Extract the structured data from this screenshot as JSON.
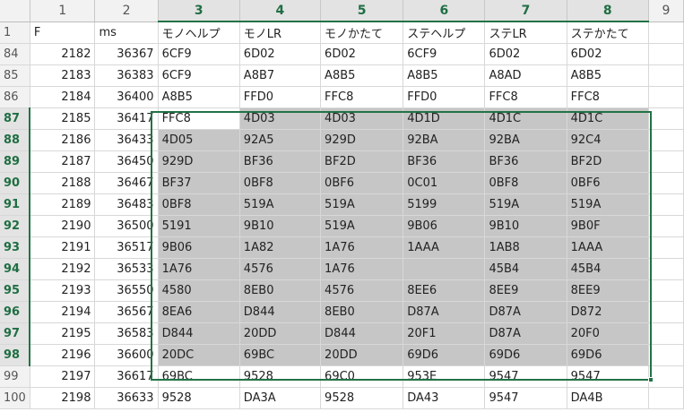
{
  "columns": {
    "headers": [
      "1",
      "2",
      "3",
      "4",
      "5",
      "6",
      "7",
      "8",
      "9"
    ],
    "selected_from": 3,
    "selected_to": 8
  },
  "rows": [
    {
      "rownum": "1",
      "cells": [
        "F",
        "ms",
        "モノヘルプ",
        "モノLR",
        "モノかたて",
        "ステヘルプ",
        "ステLR",
        "ステかたて"
      ]
    },
    {
      "rownum": "84",
      "cells": [
        "2182",
        "36367",
        "6CF9",
        "6D02",
        "6D02",
        "6CF9",
        "6D02",
        "6D02"
      ]
    },
    {
      "rownum": "85",
      "cells": [
        "2183",
        "36383",
        "6CF9",
        "A8B7",
        "A8B5",
        "A8B5",
        "A8AD",
        "A8B5"
      ]
    },
    {
      "rownum": "86",
      "cells": [
        "2184",
        "36400",
        "A8B5",
        "FFD0",
        "FFC8",
        "FFD0",
        "FFC8",
        "FFC8"
      ]
    },
    {
      "rownum": "87",
      "cells": [
        "2185",
        "36417",
        "FFC8",
        "4D03",
        "4D03",
        "4D1D",
        "4D1C",
        "4D1C"
      ]
    },
    {
      "rownum": "88",
      "cells": [
        "2186",
        "36433",
        "4D05",
        "92A5",
        "929D",
        "92BA",
        "92BA",
        "92C4"
      ]
    },
    {
      "rownum": "89",
      "cells": [
        "2187",
        "36450",
        "929D",
        "BF36",
        "BF2D",
        "BF36",
        "BF36",
        "BF2D"
      ]
    },
    {
      "rownum": "90",
      "cells": [
        "2188",
        "36467",
        "BF37",
        "0BF8",
        "0BF6",
        "0C01",
        "0BF8",
        "0BF6"
      ]
    },
    {
      "rownum": "91",
      "cells": [
        "2189",
        "36483",
        "0BF8",
        "519A",
        "519A",
        "5199",
        "519A",
        "519A"
      ]
    },
    {
      "rownum": "92",
      "cells": [
        "2190",
        "36500",
        "5191",
        "9B10",
        "519A",
        "9B06",
        "9B10",
        "9B0F"
      ]
    },
    {
      "rownum": "93",
      "cells": [
        "2191",
        "36517",
        "9B06",
        "1A82",
        "1A76",
        "1AAA",
        "1AB8",
        "1AAA"
      ]
    },
    {
      "rownum": "94",
      "cells": [
        "2192",
        "36533",
        "1A76",
        "4576",
        "1A76",
        "",
        "45B4",
        "45B4"
      ]
    },
    {
      "rownum": "95",
      "cells": [
        "2193",
        "36550",
        "4580",
        "8EB0",
        "4576",
        "8EE6",
        "8EE9",
        "8EE9"
      ]
    },
    {
      "rownum": "96",
      "cells": [
        "2194",
        "36567",
        "8EA6",
        "D844",
        "8EB0",
        "D87A",
        "D87A",
        "D872"
      ]
    },
    {
      "rownum": "97",
      "cells": [
        "2195",
        "36583",
        "D844",
        "20DD",
        "D844",
        "20F1",
        "D87A",
        "20F0"
      ]
    },
    {
      "rownum": "98",
      "cells": [
        "2196",
        "36600",
        "20DC",
        "69BC",
        "20DD",
        "69D6",
        "69D6",
        "69D6"
      ]
    },
    {
      "rownum": "99",
      "cells": [
        "2197",
        "36617",
        "69BC",
        "9528",
        "69C0",
        "953E",
        "9547",
        "9547"
      ]
    },
    {
      "rownum": "100",
      "cells": [
        "2198",
        "36633",
        "9528",
        "DA3A",
        "9528",
        "DA43",
        "9547",
        "DA4B"
      ]
    }
  ],
  "selection": {
    "first_row": "87",
    "last_row": "98",
    "active_cell": "87:3"
  },
  "colors": {
    "accent": "#217346",
    "selection_fill": "#c6c6c6",
    "header_bg": "#f2f2f2",
    "grid_line": "#d8d8d8"
  }
}
